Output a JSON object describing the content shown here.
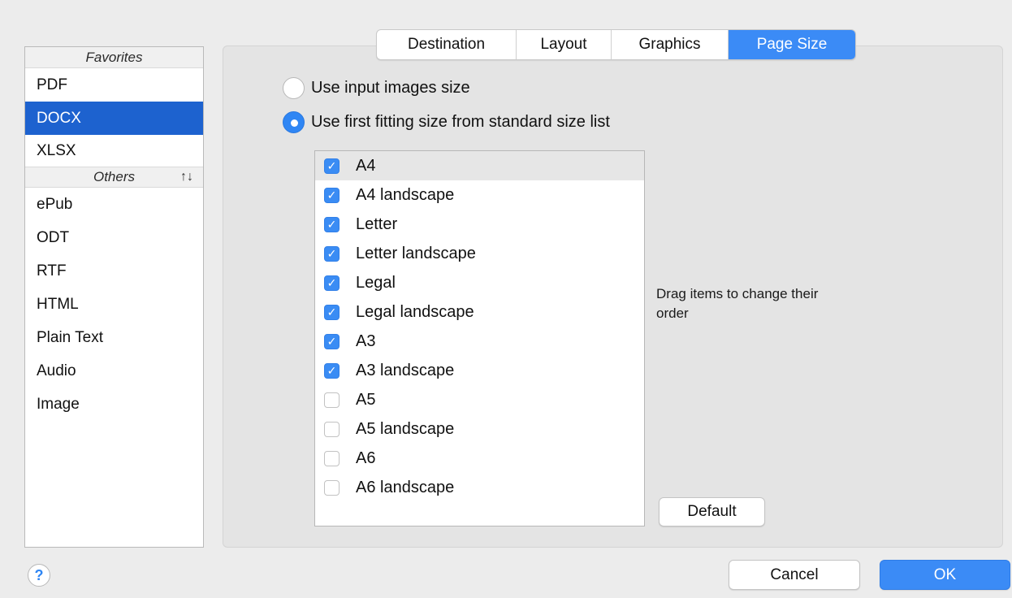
{
  "sidebar": {
    "favorites_header": "Favorites",
    "favorites": [
      "PDF",
      "DOCX",
      "XLSX"
    ],
    "selected": "DOCX",
    "others_header": "Others",
    "sort_icon": "↑↓",
    "others": [
      "ePub",
      "ODT",
      "RTF",
      "HTML",
      "Plain Text",
      "Audio",
      "Image"
    ]
  },
  "tabs": {
    "destination": "Destination",
    "layout": "Layout",
    "graphics": "Graphics",
    "page_size": "Page Size",
    "active": "Page Size"
  },
  "options": {
    "use_input_size": "Use input images size",
    "use_first_fitting": "Use first fitting size from standard size list",
    "selected": "use_first_fitting"
  },
  "sizes": [
    {
      "label": "A4",
      "checked": true
    },
    {
      "label": "A4 landscape",
      "checked": true
    },
    {
      "label": "Letter",
      "checked": true
    },
    {
      "label": "Letter landscape",
      "checked": true
    },
    {
      "label": "Legal",
      "checked": true
    },
    {
      "label": "Legal landscape",
      "checked": true
    },
    {
      "label": "A3",
      "checked": true
    },
    {
      "label": "A3 landscape",
      "checked": true
    },
    {
      "label": "A5",
      "checked": false
    },
    {
      "label": "A5 landscape",
      "checked": false
    },
    {
      "label": "A6",
      "checked": false
    },
    {
      "label": "A6 landscape",
      "checked": false
    }
  ],
  "hint": "Drag items to change their order",
  "buttons": {
    "default": "Default",
    "cancel": "Cancel",
    "ok": "OK",
    "help": "?"
  },
  "colors": {
    "accent": "#3b8bf6",
    "selection": "#1d62cf"
  }
}
